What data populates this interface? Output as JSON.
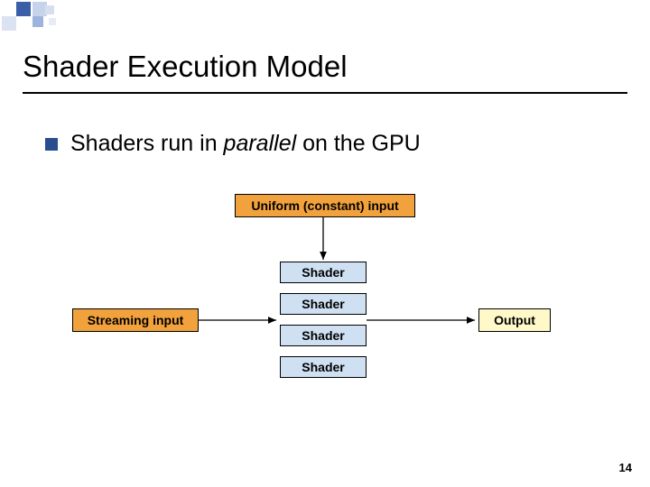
{
  "title": "Shader Execution Model",
  "bullet": {
    "pre": "Shaders run in ",
    "em": "parallel",
    "post": " on the GPU"
  },
  "boxes": {
    "uniform": "Uniform (constant) input",
    "streaming": "Streaming input",
    "shader1": "Shader",
    "shader2": "Shader",
    "shader3": "Shader",
    "shader4": "Shader",
    "output": "Output"
  },
  "page_number": "14",
  "colors": {
    "orange": "#f2a23c",
    "blue": "#cfe0f2",
    "yellow": "#fff8c9",
    "bullet": "#2a4d8f"
  }
}
